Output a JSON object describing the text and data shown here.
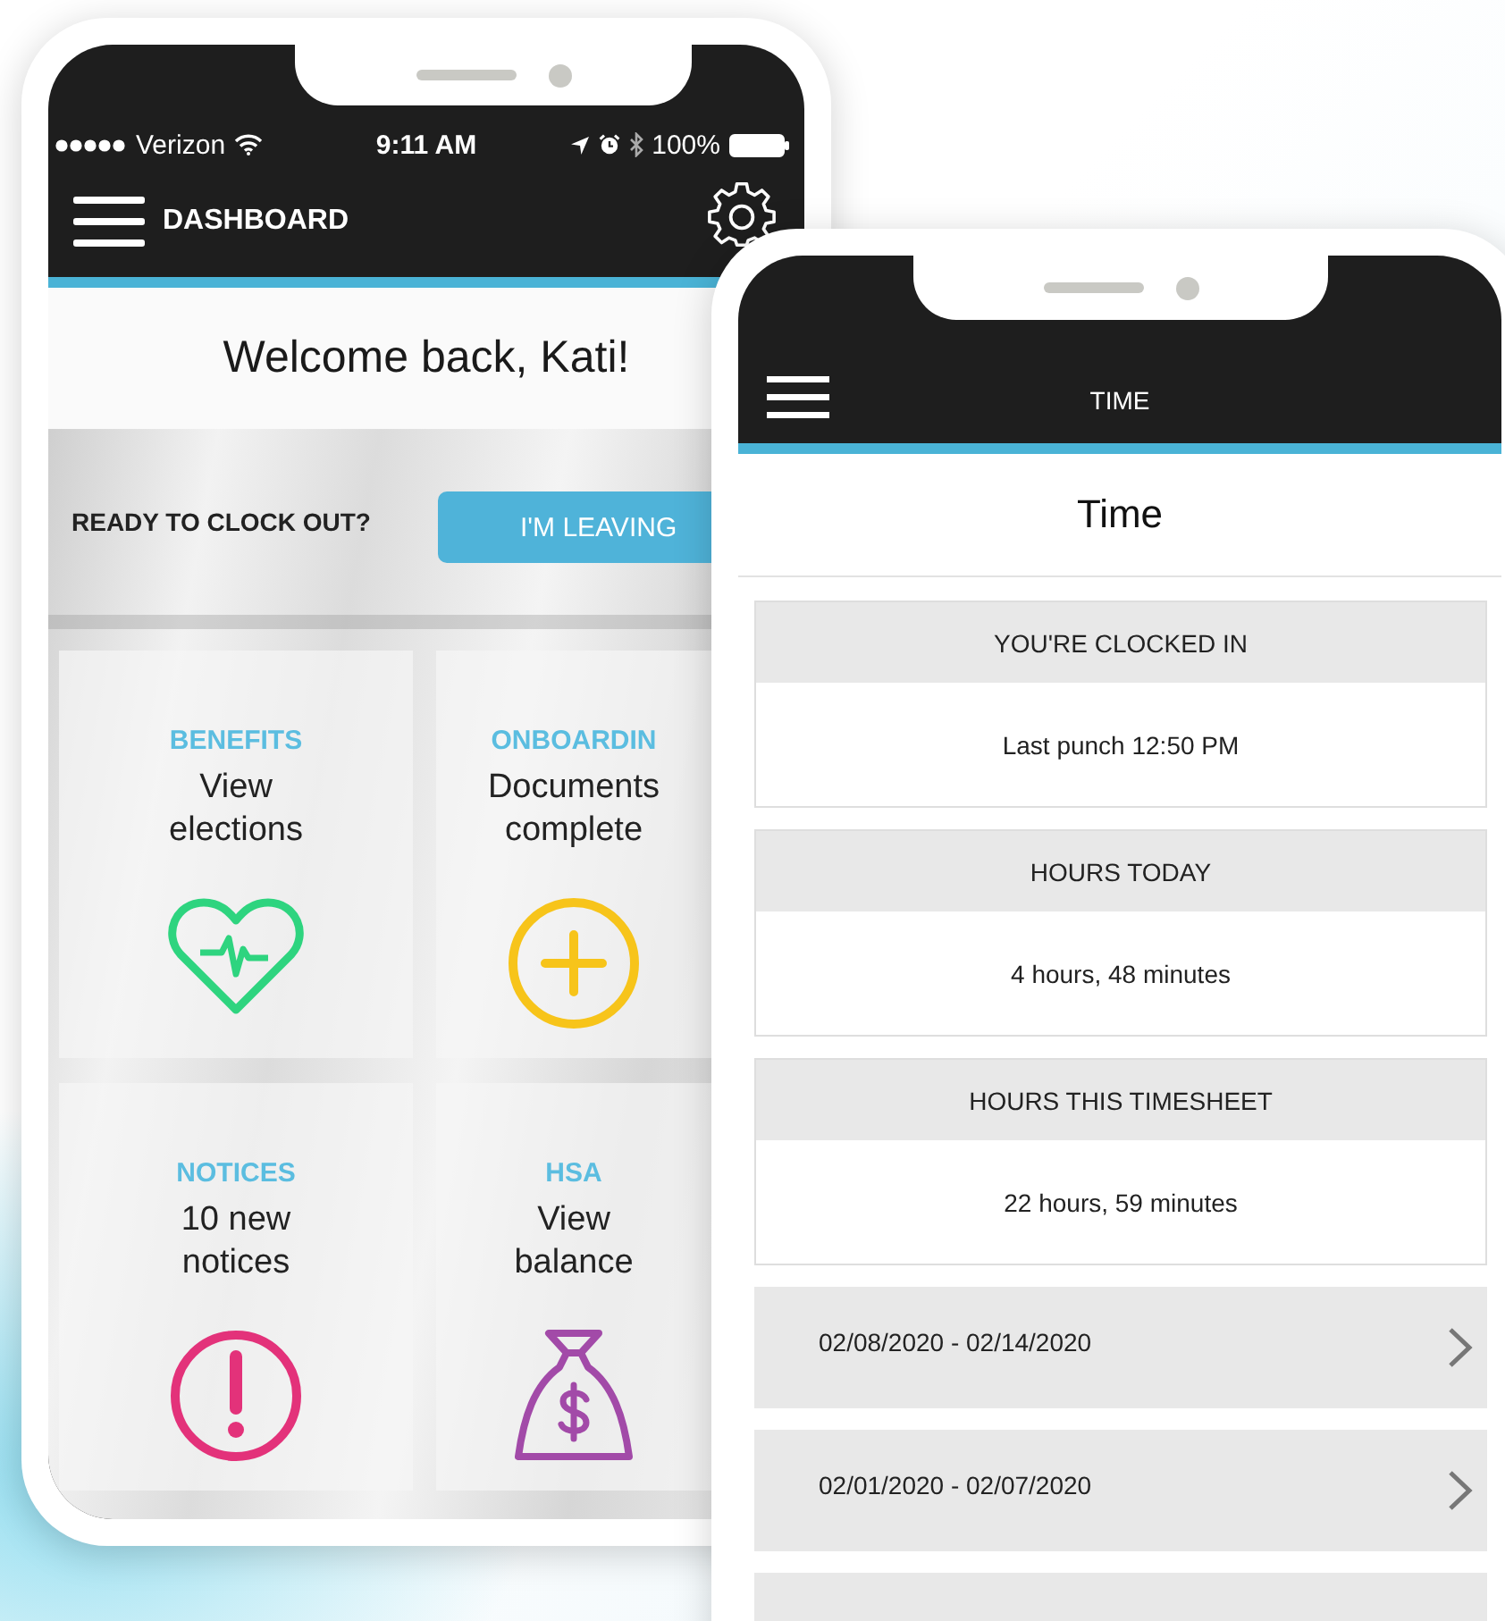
{
  "dashboard_phone": {
    "status_bar": {
      "carrier": "Verizon",
      "time": "9:11 AM",
      "battery": "100%"
    },
    "header": {
      "title": "DASHBOARD"
    },
    "welcome": "Welcome back, Kati!",
    "clock_out": {
      "prompt": "READY TO CLOCK OUT?",
      "button": "I'M LEAVING"
    },
    "tiles": [
      {
        "category": "BENEFITS",
        "text": "View elections",
        "kind": "heart",
        "color": "#2ed47f"
      },
      {
        "category": "ONBOARDIN",
        "text": "Documents complete",
        "kind": "plus",
        "color": "#f7c41a"
      },
      {
        "category": "NOTICES",
        "text": "10 new notices",
        "kind": "alert",
        "color": "#e3327a"
      },
      {
        "category": "HSA",
        "text": "View balance",
        "kind": "moneybag",
        "color": "#a24aa8"
      }
    ]
  },
  "time_phone": {
    "header": {
      "title": "TIME"
    },
    "page_title": "Time",
    "cards": [
      {
        "heading": "YOU'RE CLOCKED IN",
        "value": "Last punch 12:50 PM"
      },
      {
        "heading": "HOURS TODAY",
        "value": "4 hours, 48 minutes"
      },
      {
        "heading": "HOURS THIS TIMESHEET",
        "value": "22 hours, 59 minutes"
      }
    ],
    "periods": [
      {
        "range": "02/08/2020 - 02/14/2020"
      },
      {
        "range": "02/01/2020 - 02/07/2020"
      }
    ]
  }
}
